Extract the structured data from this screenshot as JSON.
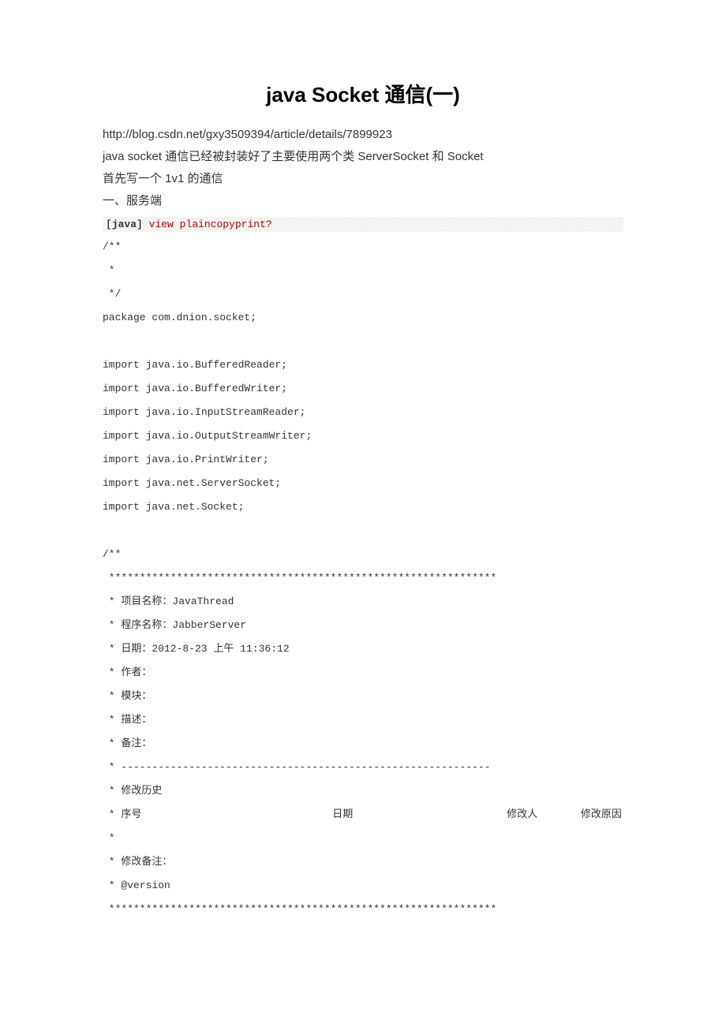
{
  "title": "java Socket 通信(一)",
  "url": "http://blog.csdn.net/gxy3509394/article/details/7899923",
  "intro1": "java socket 通信已经被封装好了主要使用两个类 ServerSocket  和 Socket",
  "intro2": "首先写一个 1v1 的通信",
  "section1": "一、服务端",
  "toolbar": {
    "bracket_open": "[",
    "lang": "java",
    "bracket_close": "] ",
    "view": "view plain",
    "copy": "copy",
    "print": "print",
    "qmark": "?"
  },
  "code": "/** \n *  \n */  \npackage com.dnion.socket;  \n  \nimport java.io.BufferedReader;  \nimport java.io.BufferedWriter;  \nimport java.io.InputStreamReader;  \nimport java.io.OutputStreamWriter;  \nimport java.io.PrintWriter;  \nimport java.net.ServerSocket;  \nimport java.net.Socket;  \n  \n/** \n ***************************************************************  \n * 项目名称：JavaThread \n * 程序名称：JabberServer \n * 日期：2012-8-23 上午 11:36:12  \n * 作者： \n * 模块：  \n * 描述：  \n * 备注：  \n * ------------------------------------------------------------  \n * 修改历史  \n * 序号                               日期                         修改人       修改原因  \n *  \n * 修改备注：  \n * @version  \n ***************************************************************  "
}
